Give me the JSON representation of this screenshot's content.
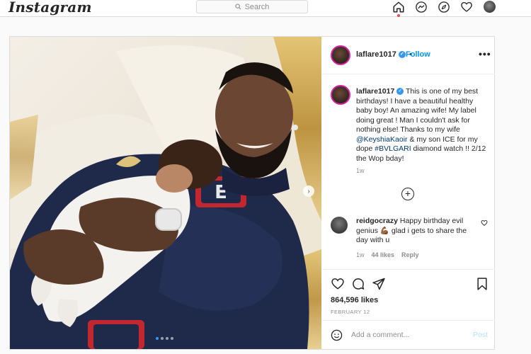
{
  "topbar": {
    "logo": "Instagram",
    "search_placeholder": "Search",
    "icons": [
      "home-icon",
      "messenger-icon",
      "explore-icon",
      "heart-icon",
      "profile-avatar"
    ]
  },
  "post": {
    "author": {
      "username": "laflare1017",
      "verified_icon": "verified-badge-icon",
      "follow_dot": "•",
      "follow_label": "Follow"
    },
    "more_label": "•••",
    "caption": {
      "username": "laflare1017",
      "text_part1": "This is one of my best birthdays! I have a beautiful healthy baby boy! An amazing wife! My label doing great ! Man I couldn't ask for nothing else! Thanks to my wife ",
      "mention": "@KeyshiaKaoir",
      "text_part2": " & my son ICE for my dope ",
      "hashtag": "#BVLGARI",
      "text_part3": " diamond watch !! 2/12 the Wop bday!",
      "age": "1w"
    },
    "comment": {
      "username": "reidgocrazy",
      "text_part1": "Happy birthday evil genius",
      "emoji": "💪🏾",
      "text_part2": " glad i gets to share the day with u",
      "age": "1w",
      "likes": "44 likes",
      "reply": "Reply"
    },
    "likes": "864,596 likes",
    "date": "FEBRUARY 12",
    "add_comment_placeholder": "Add a comment...",
    "post_label": "Post",
    "carousel_dots": 4,
    "carousel_active_index": 0
  },
  "colors": {
    "accent": "#0095f6",
    "sweater": "#1f2a4a",
    "gold": "#c9a24a"
  }
}
